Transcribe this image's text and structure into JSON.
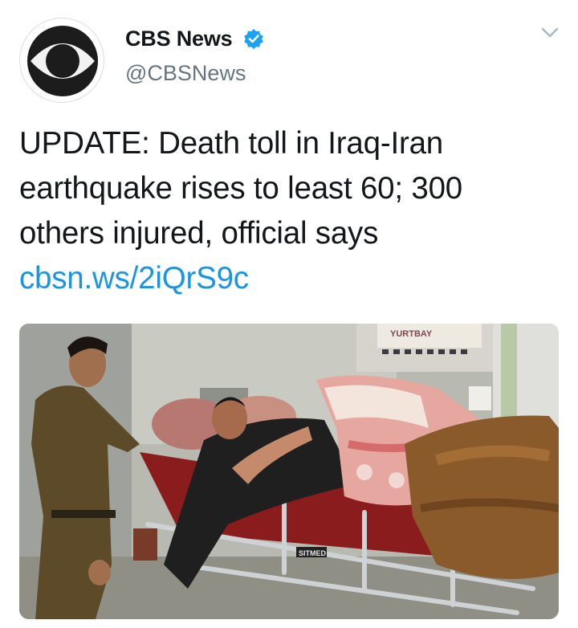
{
  "tweet": {
    "author": {
      "display_name": "CBS News",
      "handle": "@CBSNews",
      "verified_icon": "verified-badge-icon",
      "avatar_icon": "cbs-eye-logo"
    },
    "menu_icon": "chevron-down-icon",
    "text_lines": [
      "UPDATE: Death toll in Iraq-Iran",
      "earthquake rises to least 60; 300",
      "others injured, official says"
    ],
    "link": "cbsn.ws/2iQrS9c",
    "media": {
      "sign_text": "YURTBAY",
      "stretcher_label": "SITMED"
    }
  },
  "colors": {
    "link": "#1b95e0",
    "verified": "#1da1f2",
    "secondary_text": "#66757f"
  }
}
